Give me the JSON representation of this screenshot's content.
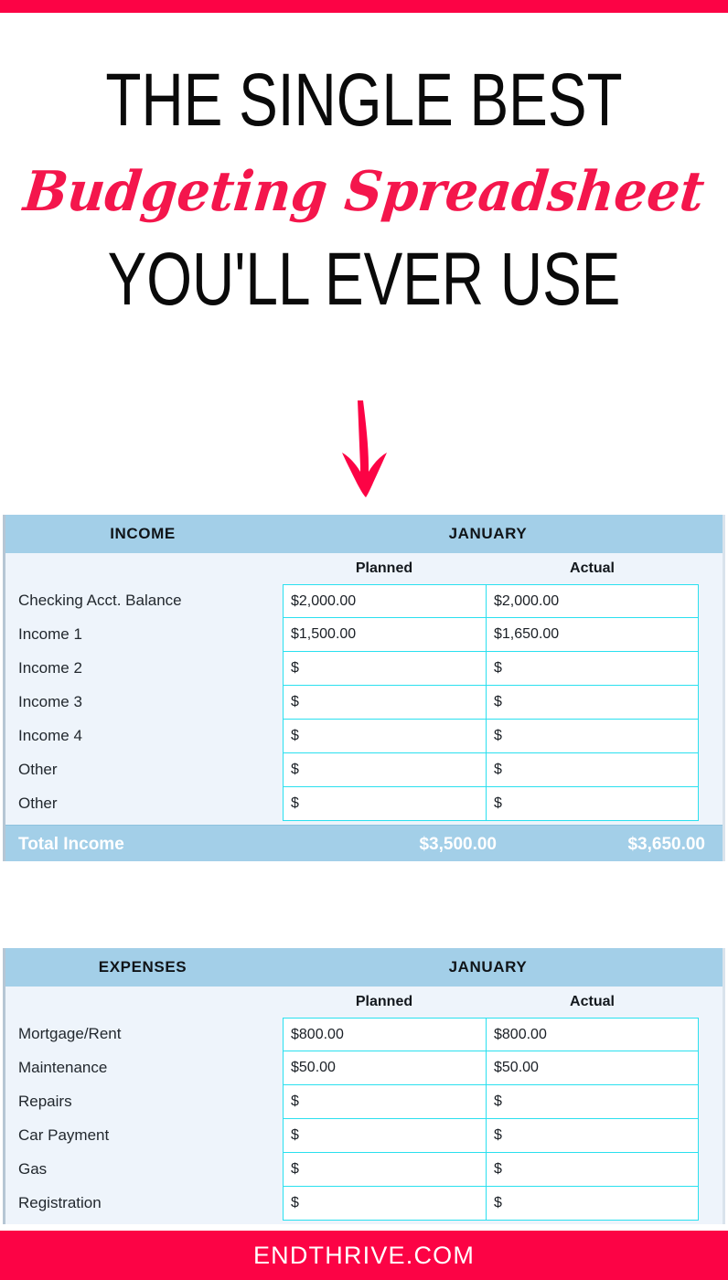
{
  "accent": {
    "pink": "#fc0345",
    "script_pink": "#f4164c",
    "header_blue": "#a3cfe8",
    "body_blue": "#eef4fb",
    "cell_border_cyan": "#2ae0ef"
  },
  "headline": {
    "line1": "THE SINGLE BEST",
    "line2": "Budgeting Spreadsheet",
    "line3": "YOU'LL EVER USE",
    "arrow_icon": "down-arrow-icon"
  },
  "footer": {
    "site": "ENDTHRIVE.COM"
  },
  "income": {
    "category": "INCOME",
    "month": "JANUARY",
    "col_planned": "Planned",
    "col_actual": "Actual",
    "rows": [
      {
        "label": "Checking Acct. Balance",
        "planned": "$2,000.00",
        "actual": "$2,000.00"
      },
      {
        "label": "Income 1",
        "planned": "$1,500.00",
        "actual": "$1,650.00"
      },
      {
        "label": "Income 2",
        "planned": "$",
        "actual": "$"
      },
      {
        "label": "Income 3",
        "planned": "$",
        "actual": "$"
      },
      {
        "label": "Income 4",
        "planned": "$",
        "actual": "$"
      },
      {
        "label": "Other",
        "planned": "$",
        "actual": "$"
      },
      {
        "label": "Other",
        "planned": "$",
        "actual": "$"
      }
    ],
    "total_label": "Total Income",
    "total_planned": "$3,500.00",
    "total_actual": "$3,650.00"
  },
  "expenses": {
    "category": "EXPENSES",
    "month": "JANUARY",
    "col_planned": "Planned",
    "col_actual": "Actual",
    "rows": [
      {
        "label": "Mortgage/Rent",
        "planned": "$800.00",
        "actual": "$800.00"
      },
      {
        "label": "Maintenance",
        "planned": "$50.00",
        "actual": "$50.00"
      },
      {
        "label": "Repairs",
        "planned": "$",
        "actual": "$"
      },
      {
        "label": "Car Payment",
        "planned": "$",
        "actual": "$"
      },
      {
        "label": "Gas",
        "planned": "$",
        "actual": "$"
      },
      {
        "label": "Registration",
        "planned": "$",
        "actual": "$"
      }
    ]
  }
}
